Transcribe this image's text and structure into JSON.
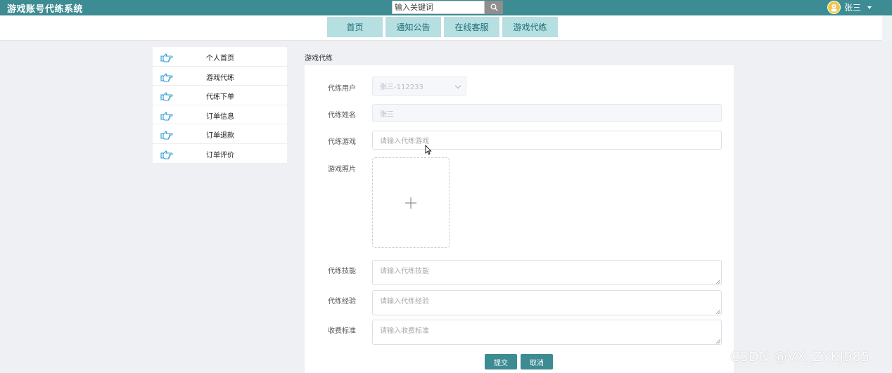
{
  "app": {
    "title": "游戏账号代练系统"
  },
  "search": {
    "placeholder": "输入关键词"
  },
  "user": {
    "name": "张三"
  },
  "nav": {
    "items": [
      "首页",
      "通知公告",
      "在线客服",
      "游戏代练"
    ]
  },
  "sidebar": {
    "items": [
      {
        "label": "个人首页",
        "icon": "pointing-hand-icon"
      },
      {
        "label": "游戏代练",
        "icon": "pointing-hand-icon"
      },
      {
        "label": "代练下单",
        "icon": "pointing-hand-icon"
      },
      {
        "label": "订单信息",
        "icon": "pointing-hand-icon"
      },
      {
        "label": "订单退款",
        "icon": "pointing-hand-icon"
      },
      {
        "label": "订单评价",
        "icon": "pointing-hand-icon"
      }
    ]
  },
  "breadcrumb": "游戏代练",
  "form": {
    "user_label": "代练用户",
    "user_value": "张三-112233",
    "name_label": "代练姓名",
    "name_value": "张三",
    "game_label": "代练游戏",
    "game_placeholder": "请输入代练游戏",
    "photo_label": "游戏照片",
    "skill_label": "代练技能",
    "skill_placeholder": "请输入代练技能",
    "exp_label": "代练经验",
    "exp_placeholder": "请输入代练经验",
    "fee_label": "收费标准",
    "fee_placeholder": "请输入收费标准",
    "submit_label": "提交",
    "cancel_label": "取消"
  },
  "watermark": "CSDN @VX_ZYKJ985",
  "colors": {
    "primary": "#3d8b93",
    "nav_bg": "#b6dfe2",
    "page_bg": "#eef0f3"
  }
}
